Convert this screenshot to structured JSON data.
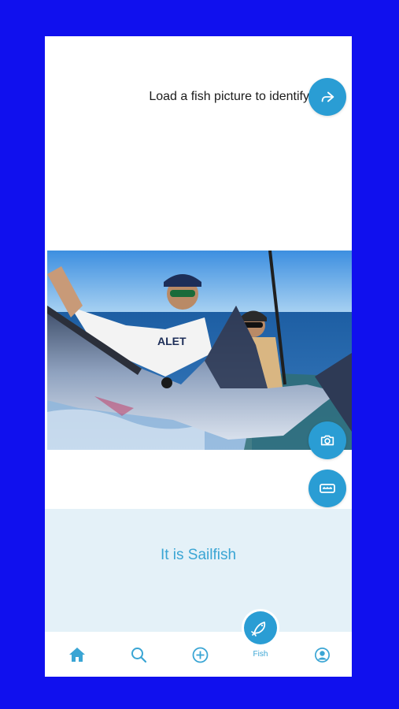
{
  "screen": {
    "prompt": "Load a fish picture to identify",
    "result": "It is Sailfish"
  },
  "buttons": {
    "share": "share-icon",
    "camera": "camera-icon",
    "gallery": "image-icon"
  },
  "tabbar": {
    "items": [
      {
        "icon": "home-icon"
      },
      {
        "icon": "search-icon"
      },
      {
        "icon": "add-circle-icon"
      },
      {
        "icon": "fish-icon",
        "label": "Fish",
        "active": true
      },
      {
        "icon": "profile-icon"
      }
    ]
  },
  "colors": {
    "accent": "#2a9dd4",
    "result_bg": "#e4f1f8",
    "backdrop": "#1010ee"
  }
}
